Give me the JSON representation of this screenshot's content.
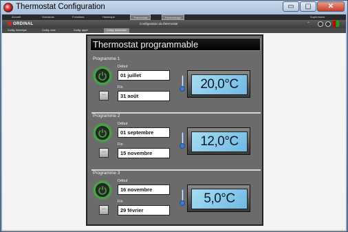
{
  "window": {
    "title": "Thermostat Configuration",
    "controls": {
      "minimize": "▭",
      "maximize": "▢",
      "close": "✕"
    }
  },
  "menubar": {
    "items": [
      {
        "label": "Accueil"
      },
      {
        "label": "Scenarios"
      },
      {
        "label": "Fonctions"
      },
      {
        "label": "Historique"
      },
      {
        "label": "Thermostat"
      },
      {
        "label": "Parametrage"
      }
    ],
    "status": "Superviseur"
  },
  "header": {
    "brand": "ORDINAL",
    "title": "Configuration du thermostat",
    "icons": [
      "chevron-up-icon",
      "minus-icon",
      "settings-icon",
      "flag-icon"
    ]
  },
  "tabs": [
    {
      "label": "Config. thermique"
    },
    {
      "label": "Config. zone"
    },
    {
      "label": "Config. appel"
    },
    {
      "label": "Config. thermostat"
    }
  ],
  "panel": {
    "title": "Thermostat programmable",
    "start_label": "Début",
    "end_label": "Fin",
    "dots_label": "...",
    "programs": [
      {
        "label": "Programme 1",
        "start": "01 juillet",
        "end": "31 août",
        "temperature": "20,0°C"
      },
      {
        "label": "Programme 2",
        "start": "01 septembre",
        "end": "15 novembre",
        "temperature": "12,0°C"
      },
      {
        "label": "Programme 3",
        "start": "16 novembre",
        "end": "29 février",
        "temperature": "5,0°C"
      }
    ]
  },
  "colors": {
    "power_glow": "#3ca83c",
    "display_bg": "#8ccbee",
    "panel_bg": "#6b6b6b"
  }
}
